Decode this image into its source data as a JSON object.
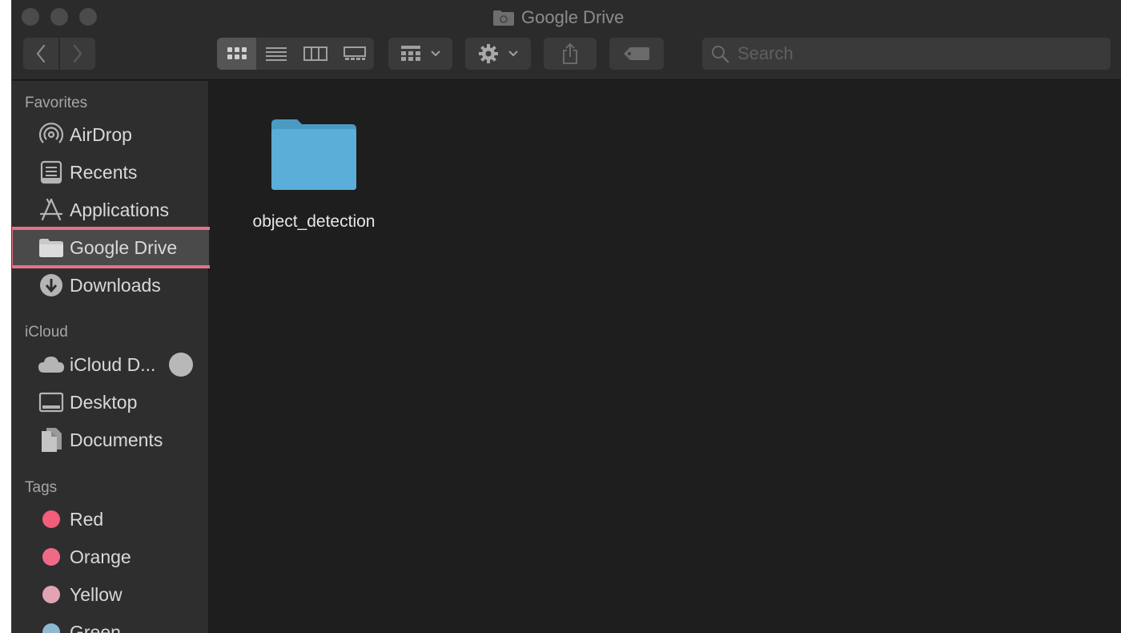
{
  "window": {
    "title": "Google Drive"
  },
  "toolbar": {
    "search_placeholder": "Search",
    "active_view": "icon"
  },
  "sidebar": {
    "favorites_title": "Favorites",
    "favorites": [
      {
        "label": "AirDrop",
        "icon": "airdrop-icon"
      },
      {
        "label": "Recents",
        "icon": "recents-icon"
      },
      {
        "label": "Applications",
        "icon": "applications-icon"
      },
      {
        "label": "Google Drive",
        "icon": "folder-icon",
        "selected": true
      },
      {
        "label": "Downloads",
        "icon": "downloads-icon"
      }
    ],
    "icloud_title": "iCloud",
    "icloud": [
      {
        "label": "iCloud D...",
        "icon": "cloud-icon"
      },
      {
        "label": "Desktop",
        "icon": "desktop-icon"
      },
      {
        "label": "Documents",
        "icon": "documents-icon"
      }
    ],
    "tags_title": "Tags",
    "tags": [
      {
        "label": "Red",
        "color": "#f25d7a"
      },
      {
        "label": "Orange",
        "color": "#f06a88"
      },
      {
        "label": "Yellow",
        "color": "#e3a3b3"
      },
      {
        "label": "Green",
        "color": "#8fb8d1"
      }
    ]
  },
  "content": {
    "items": [
      {
        "name": "object_detection",
        "type": "folder",
        "color": "#5aaed8"
      }
    ]
  },
  "colors": {
    "highlight": "#e8708a",
    "folder": "#5aaed8"
  }
}
